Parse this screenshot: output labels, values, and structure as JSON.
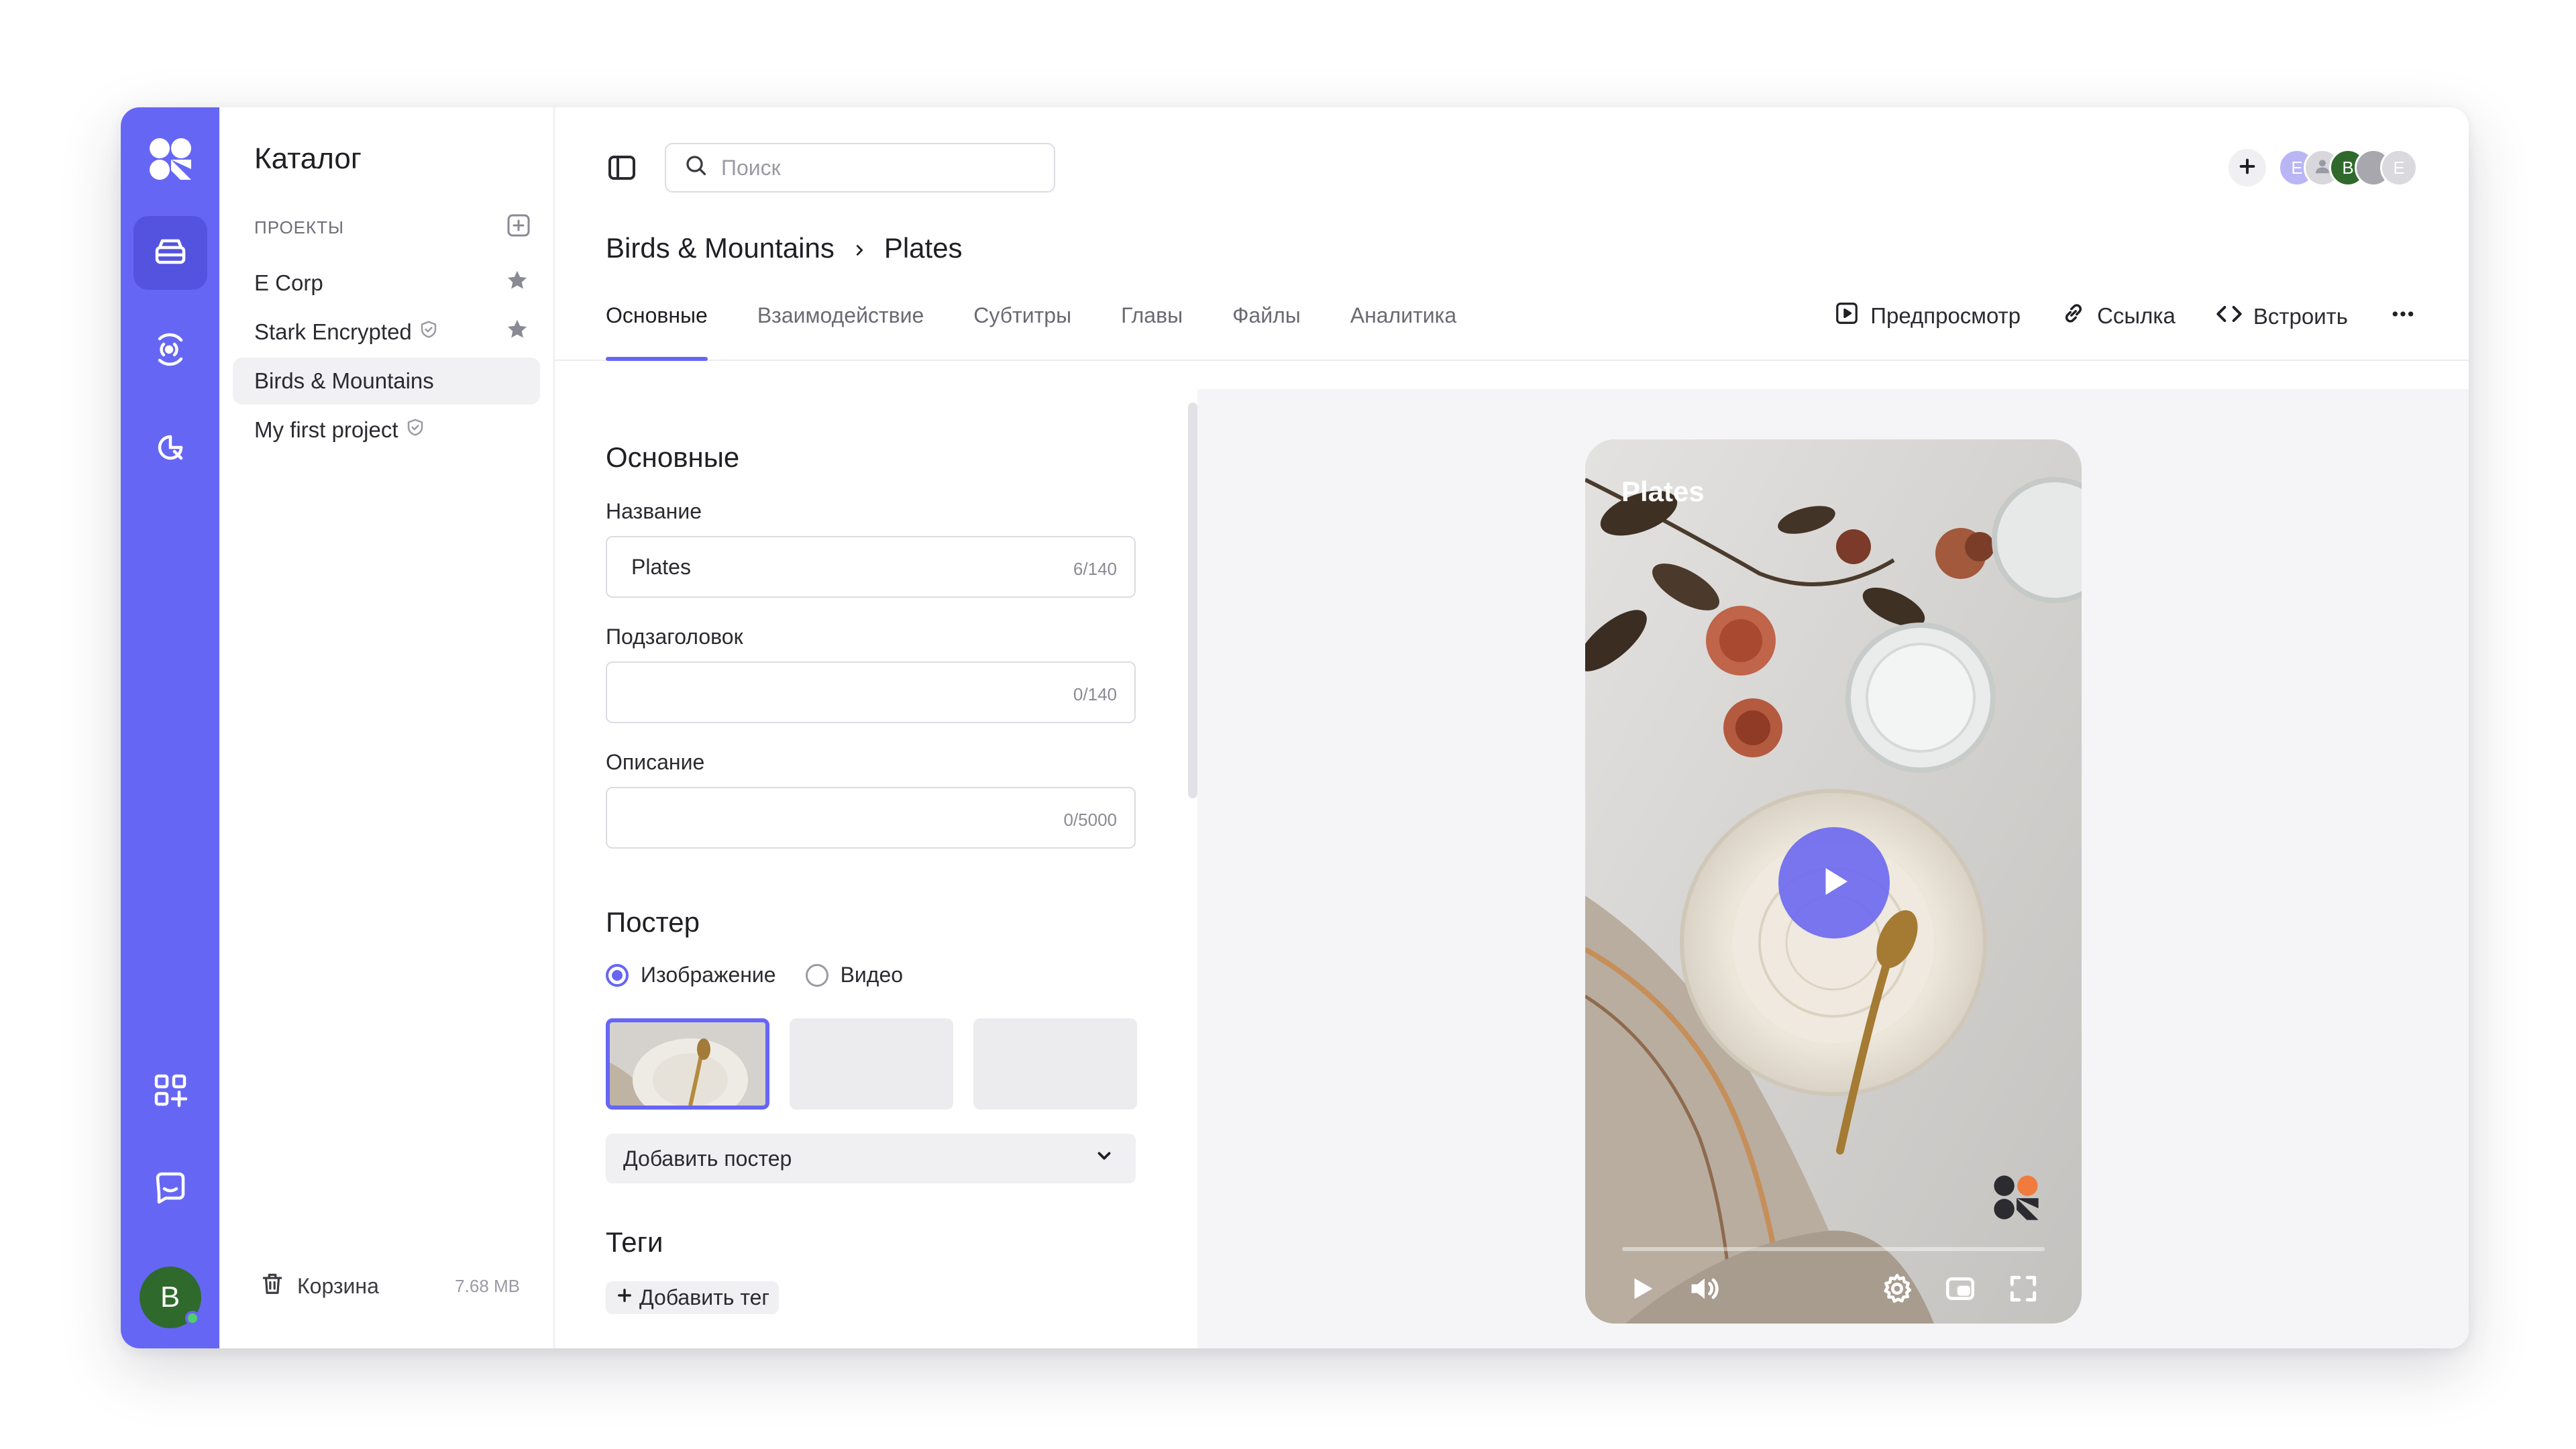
{
  "app": {
    "accent": "#6666f5",
    "rail": {
      "nav": [
        "storage-icon",
        "broadcast-icon",
        "analytics-icon"
      ],
      "bottom": [
        "apps-icon",
        "chat-icon"
      ],
      "user_initial": "B"
    }
  },
  "catalog": {
    "title": "Каталог",
    "projects_label": "ПРОЕКТЫ",
    "projects": [
      {
        "name": "E Corp",
        "starred": true
      },
      {
        "name": "Stark Encrypted",
        "shield": true,
        "starred": true
      },
      {
        "name": "Birds & Mountains",
        "selected": true
      },
      {
        "name": "My first project",
        "shield": true
      }
    ],
    "trash_label": "Корзина",
    "trash_size": "7.68 MB"
  },
  "topbar": {
    "search_placeholder": "Поиск",
    "avatars": [
      {
        "initial": "E",
        "color": "#b9b6f5"
      },
      {
        "initial": "",
        "color": "#d7d7dc"
      },
      {
        "initial": "B",
        "color": "#2f6a2c"
      },
      {
        "initial": "",
        "color": "#a7a7ad"
      },
      {
        "initial": "E",
        "color": "#d9d9de"
      }
    ]
  },
  "breadcrumb": {
    "parent": "Birds & Mountains",
    "current": "Plates"
  },
  "tabs": {
    "items": [
      "Основные",
      "Взаимодействие",
      "Субтитры",
      "Главы",
      "Файлы",
      "Аналитика"
    ],
    "active": 0,
    "preview_label": "Предпросмотр",
    "link_label": "Ссылка",
    "embed_label": "Встроить"
  },
  "form": {
    "section_title": "Основные",
    "title_label": "Название",
    "title_value": "Plates",
    "title_count": "6/140",
    "subtitle_label": "Подзаголовок",
    "subtitle_count": "0/140",
    "description_label": "Описание",
    "description_count": "0/5000",
    "poster_title": "Постер",
    "poster_option_image": "Изображение",
    "poster_option_video": "Видео",
    "poster_selected": "image",
    "add_poster_label": "Добавить постер",
    "tags_title": "Теги",
    "add_tag_label": "Добавить тег"
  },
  "player": {
    "title": "Plates",
    "progress": 0,
    "controls": [
      "play-icon",
      "volume-icon",
      "settings-icon",
      "pip-icon",
      "fullscreen-icon"
    ]
  }
}
